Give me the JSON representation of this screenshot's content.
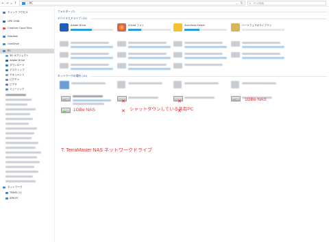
{
  "addressbar": {
    "back": "←",
    "forward": "→",
    "down": "⌄",
    "up": "↑",
    "path_sep": "›",
    "location": "PC",
    "dropdown": "⌄",
    "refresh": "↻"
  },
  "search": {
    "icon": "⌕",
    "placeholder": "PCの検索"
  },
  "sidebar": {
    "quick_access": "クイック アクセス",
    "items": [
      {
        "label": "UPS 1938"
      },
      {
        "label": "Creative Cloud Files"
      },
      {
        "label": "Dropbox"
      },
      {
        "label": "OneDrive"
      },
      {
        "label": "PC"
      },
      {
        "label": "3D オブジェクト"
      },
      {
        "label": "Adobe Drive"
      },
      {
        "label": "ダウンロード"
      },
      {
        "label": "デスクトップ"
      },
      {
        "label": "ドキュメント"
      },
      {
        "label": "ピクチャ"
      },
      {
        "label": "ビデオ"
      },
      {
        "label": "ミュージック"
      }
    ],
    "network": "ネットワーク",
    "net_items": [
      {
        "label": "TRASS-11"
      },
      {
        "label": "XRK-PC"
      }
    ]
  },
  "main": {
    "folders_header": "フォルダー (7)",
    "devices_header": "デバイスとドライブ (15)",
    "devices": [
      {
        "name": "Adobe Drive",
        "color": "#1d5fb8",
        "fill": 0.5
      },
      {
        "name": "iCloud フォト",
        "color": "#e9a23b",
        "fill": 0.3
      },
      {
        "name": "ScanSnap Folder",
        "color": "#f1c232",
        "fill": 0.35
      },
      {
        "name": "ハードウェアのライブラリ",
        "color": "#d9b45a",
        "fill": 0.0
      }
    ],
    "network_header": "ネットワークの場所 (10)"
  },
  "annotations": {
    "nas_label_1": "1GBe NAS",
    "nas_label_2": "1GBe NAS",
    "shutdown_label": "シャットダウンしている共有PC",
    "terramaster_label": "T: TerraMaster NAS ネットワークドライブ"
  },
  "colors": {
    "accent": "#26a0da",
    "annotation": "#e03030",
    "selected": "#d9d9d9",
    "group_header": "#1e4f8c"
  },
  "icons": {
    "x_mark": "✕"
  }
}
